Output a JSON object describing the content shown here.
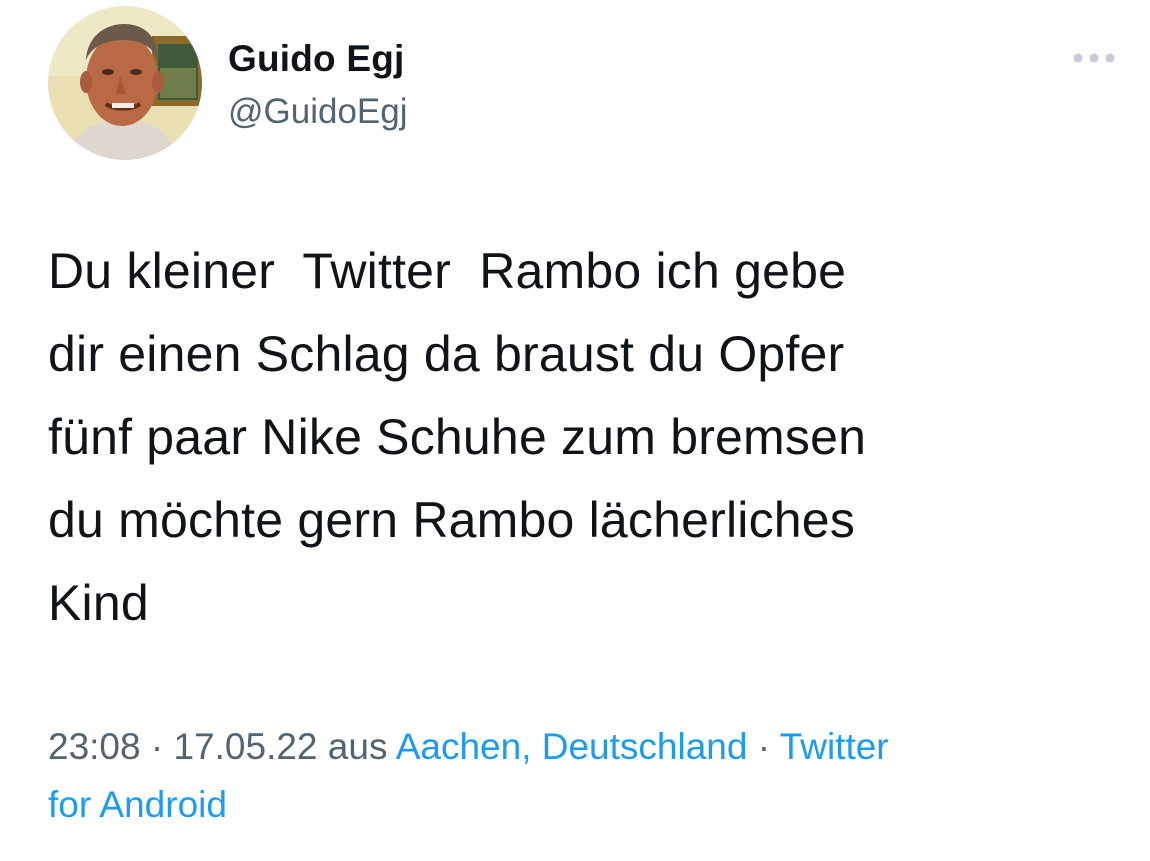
{
  "tweet": {
    "author": {
      "display_name": "Guido Egj",
      "handle": "@GuidoEgj"
    },
    "more_icon": "more-horizontal-icon",
    "text_lines": [
      "Du kleiner  Twitter  Rambo ich gebe",
      "dir einen Schlag da braust du Opfer",
      "fünf paar Nike Schuhe zum bremsen",
      "du möchte gern Rambo lächerliches",
      "Kind"
    ],
    "meta": {
      "time": "23:08",
      "sep1": " · ",
      "date": "17.05.22",
      "from_word": " aus ",
      "location": "Aachen, Deutschland",
      "sep2": " · ",
      "source_line1": "Twitter",
      "source_line2": "for Android"
    },
    "colors": {
      "text": "#0f1419",
      "secondary": "#536471",
      "link": "#1d9bf0"
    }
  }
}
